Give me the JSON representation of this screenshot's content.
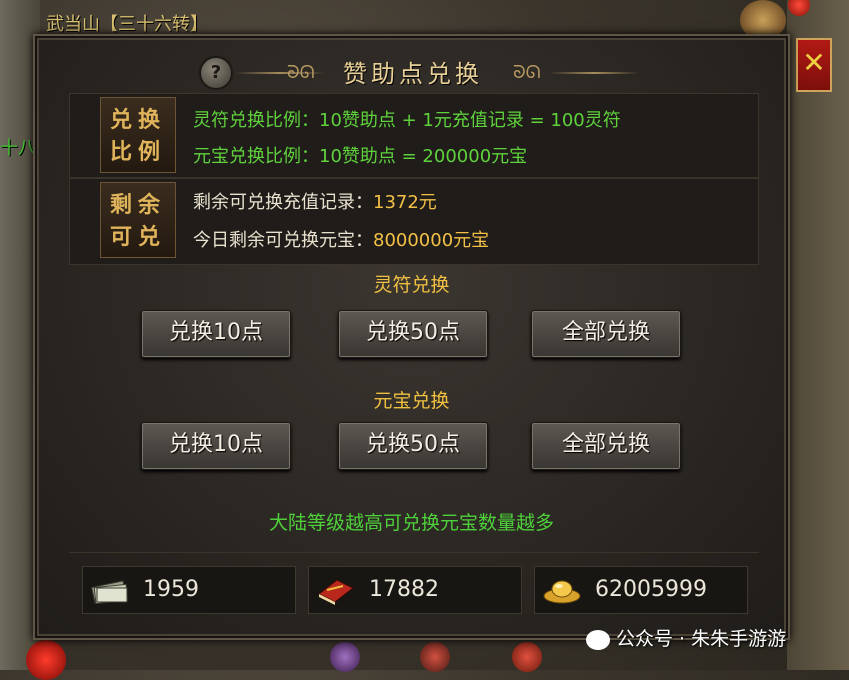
{
  "background": {
    "map_label": "武当山【三十六转】",
    "left_label": "十八"
  },
  "dialog": {
    "title": "赞助点兑换",
    "help_symbol": "?",
    "close_symbol": "✕"
  },
  "info": {
    "ratio_seal": [
      "兑换",
      "比例"
    ],
    "remaining_seal": [
      "剩余",
      "可兑"
    ],
    "lingfu_ratio": "灵符兑换比例：10赞助点 + 1元充值记录 = 100灵符",
    "yuanbao_ratio": "元宝兑换比例：10赞助点 = 200000元宝",
    "remaining_recharge_label": "剩余可兑换充值记录：",
    "remaining_recharge_value": "1372元",
    "today_yuanbao_label": "今日剩余可兑换元宝：",
    "today_yuanbao_value": "8000000元宝"
  },
  "lingfu_section": {
    "title": "灵符兑换",
    "buttons": [
      "兑换10点",
      "兑换50点",
      "全部兑换"
    ]
  },
  "yuanbao_section": {
    "title": "元宝兑换",
    "buttons": [
      "兑换10点",
      "兑换50点",
      "全部兑换"
    ]
  },
  "hint": "大陆等级越高可兑换元宝数量越多",
  "resources": [
    {
      "icon": "money-stack-icon",
      "value": "1959"
    },
    {
      "icon": "red-book-icon",
      "value": "17882"
    },
    {
      "icon": "gold-ingot-icon",
      "value": "62005999"
    }
  ],
  "watermark": "公众号 · 朱朱手游游",
  "colors": {
    "green_text": "#5fd23c",
    "gold_text": "#f2c046",
    "close_red": "#b21a14"
  }
}
